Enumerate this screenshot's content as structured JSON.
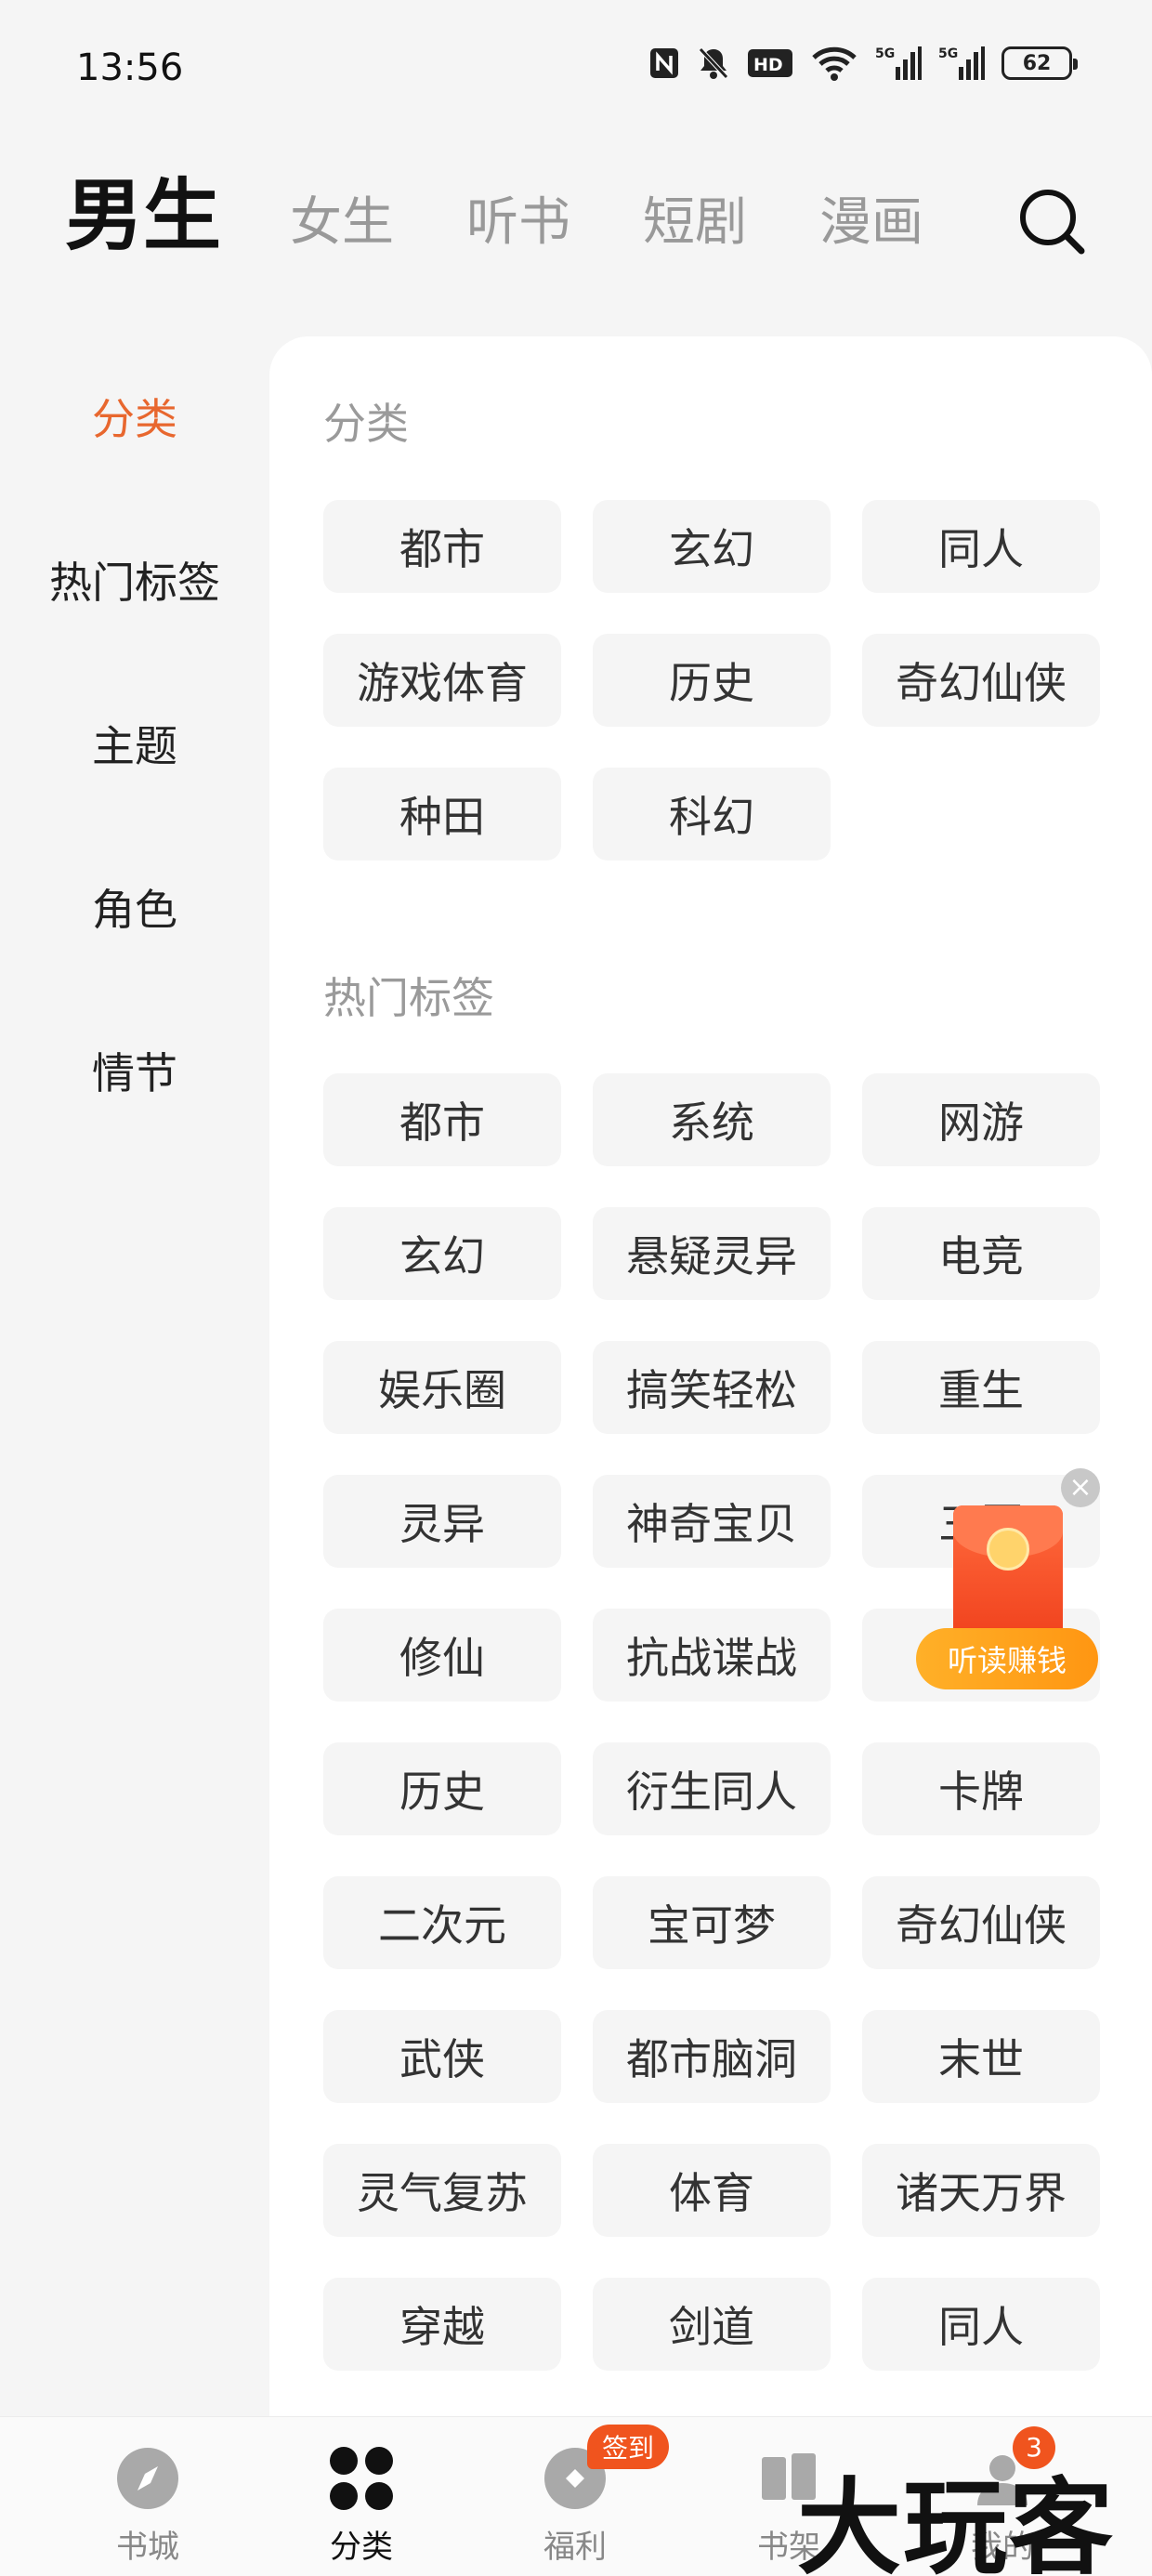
{
  "status_bar": {
    "time": "13:56",
    "battery": "62",
    "icons": [
      "nfc-icon",
      "mute-icon",
      "hd-icon",
      "wifi-icon",
      "5g-signal-icon",
      "5g-signal-icon",
      "battery-icon"
    ],
    "hd_text": "HD",
    "net_a": "5G",
    "net_b": "5G"
  },
  "top_tabs": [
    {
      "label": "男生",
      "active": true
    },
    {
      "label": "女生",
      "active": false
    },
    {
      "label": "听书",
      "active": false
    },
    {
      "label": "短剧",
      "active": false
    },
    {
      "label": "漫画",
      "active": false
    }
  ],
  "sidebar": {
    "items": [
      {
        "label": "分类",
        "active": true
      },
      {
        "label": "热门标签",
        "active": false
      },
      {
        "label": "主题",
        "active": false
      },
      {
        "label": "角色",
        "active": false
      },
      {
        "label": "情节",
        "active": false
      }
    ]
  },
  "main": {
    "category_title": "分类",
    "categories": [
      "都市",
      "玄幻",
      "同人",
      "游戏体育",
      "历史",
      "奇幻仙侠",
      "种田",
      "科幻"
    ],
    "hot_tags_title": "热门标签",
    "hot_tags": [
      "都市",
      "系统",
      "网游",
      "玄幻",
      "悬疑灵异",
      "电竞",
      "娱乐圈",
      "搞笑轻松",
      "重生",
      "灵异",
      "神奇宝贝",
      "三国",
      "修仙",
      "抗战谍战",
      "",
      "历史",
      "衍生同人",
      "卡牌",
      "二次元",
      "宝可梦",
      "奇幻仙侠",
      "武侠",
      "都市脑洞",
      "末世",
      "灵气复苏",
      "体育",
      "诸天万界",
      "穿越",
      "剑道",
      "同人"
    ]
  },
  "float_packet": {
    "label": "听读赚钱",
    "close": "×"
  },
  "bottom_nav": [
    {
      "label": "书城",
      "icon": "compass-icon"
    },
    {
      "label": "分类",
      "icon": "grid-icon",
      "active": true
    },
    {
      "label": "福利",
      "icon": "gift-icon",
      "badge": "签到"
    },
    {
      "label": "书架",
      "icon": "bookshelf-icon"
    },
    {
      "label": "我的",
      "icon": "profile-icon",
      "count": "3"
    }
  ],
  "watermark": "大玩客",
  "colors": {
    "accent": "#e8672e",
    "chip_bg": "#f5f5f5",
    "badge": "#f0541e",
    "packet": "#f0401c"
  }
}
